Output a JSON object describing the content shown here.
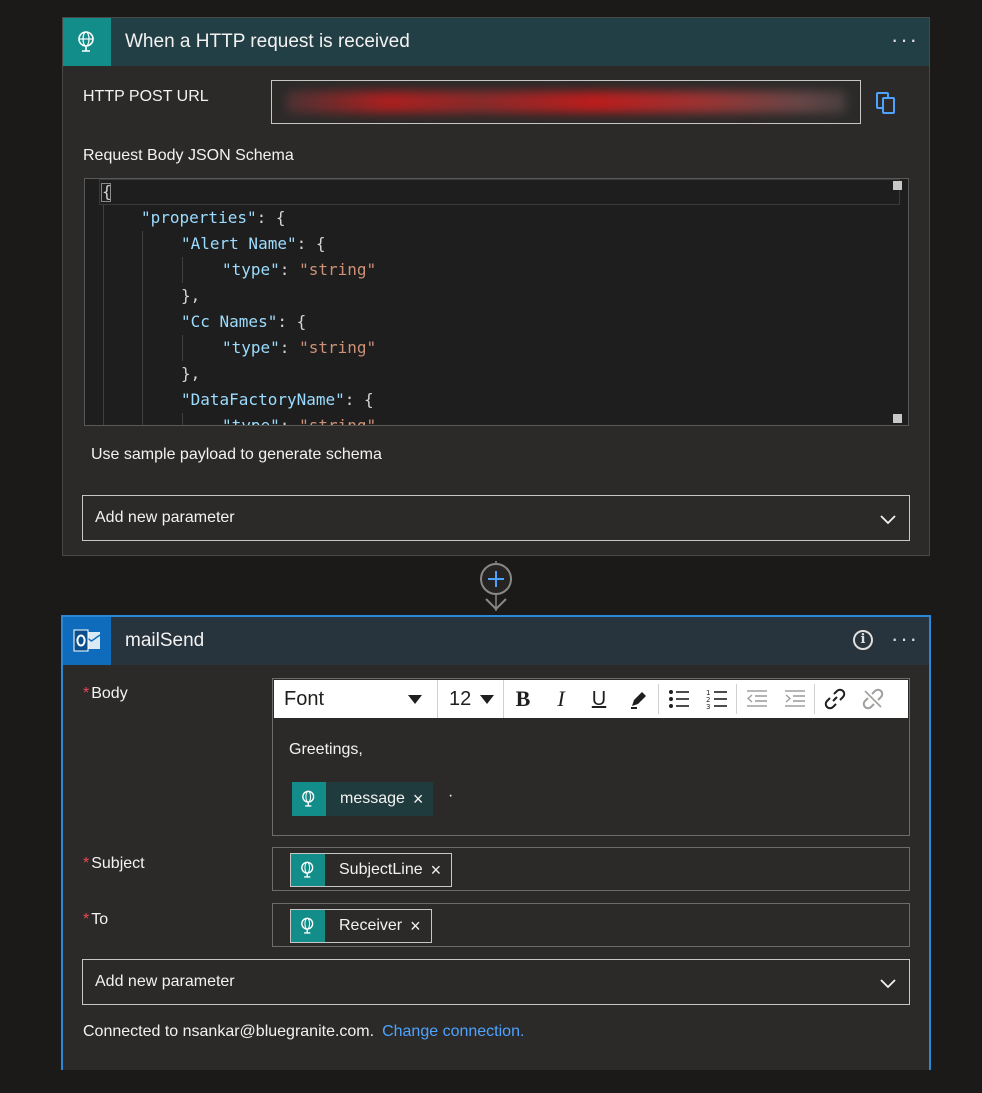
{
  "trigger": {
    "title": "When a HTTP request is received",
    "more_icon": "ellipsis-icon",
    "url_label": "HTTP POST URL",
    "schema_label": "Request Body JSON Schema",
    "schema_lines": [
      "{",
      "\"properties\": {",
      "\"Alert Name\": {",
      "\"type\": \"string\"",
      "},",
      "\"Cc Names\": {",
      "\"type\": \"string\"",
      "},",
      "\"DataFactoryName\": {",
      "\"type\": \"string\""
    ],
    "sample_payload_link": "Use sample payload to generate schema",
    "add_param_label": "Add new parameter"
  },
  "action": {
    "title": "mailSend",
    "body_label": "Body",
    "subject_label": "Subject",
    "to_label": "To",
    "required_mark": "*",
    "toolbar": {
      "font": "Font",
      "size": "12",
      "bold": "B",
      "italic": "I",
      "underline": "U"
    },
    "body_text": "Greetings,",
    "body_token": "message",
    "body_trailing": "·",
    "subject_token": "SubjectLine",
    "to_token": "Receiver",
    "token_remove": "×",
    "add_param_label": "Add new parameter",
    "connection_text": "Connected to nsankar@bluegranite.com.",
    "change_connection": "Change connection."
  },
  "colors": {
    "background": "#1b1a19",
    "card": "#2b2a29",
    "trigger_accent": "#138d8a",
    "outlook_accent": "#0f6cbd",
    "selected_border": "#2b88d8",
    "link": "#4da3ff",
    "json_key": "#9cdcfe",
    "json_string": "#ce9178"
  }
}
